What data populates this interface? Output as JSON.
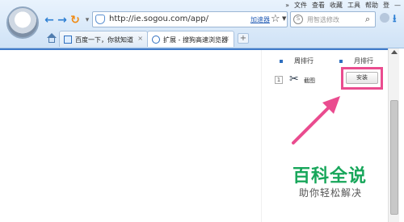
{
  "menubar": {
    "more": "»",
    "items": [
      "文件",
      "查看",
      "收藏",
      "工具",
      "帮助"
    ],
    "login": "登",
    "minimize": "—"
  },
  "toolbar": {
    "address_url": "http://ie.sogou.com/app/",
    "accelerator_label": "加速器",
    "search_placeholder": "用智选修改",
    "search_engine_icon": "s-logo-icon"
  },
  "tabs": [
    {
      "label": "百度一下，你就知道",
      "close": "×"
    },
    {
      "label": "扩展 - 搜狗高速浏览器",
      "close": "×"
    }
  ],
  "new_tab": "+",
  "sidebar": {
    "week_tab": "周排行",
    "month_tab": "月排行",
    "row": {
      "rank": "1",
      "name": "截图",
      "install_label": "安装"
    }
  },
  "watermark": {
    "title": "百科全说",
    "subtitle": "助你轻松解决"
  },
  "colors": {
    "highlight": "#ea4c8f",
    "watermark_green": "#17a65a",
    "accent_blue": "#3f7ac9"
  }
}
